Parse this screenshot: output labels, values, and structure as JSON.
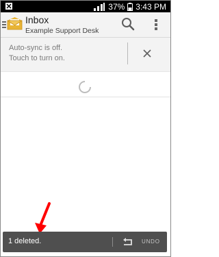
{
  "status": {
    "battery_percent": "37%",
    "time": "3:43 PM"
  },
  "header": {
    "title": "Inbox",
    "account": "Example Support Desk"
  },
  "banner": {
    "line1": "Auto-sync is off.",
    "line2": "Touch to turn on."
  },
  "toast": {
    "message": "1 deleted.",
    "action": "UNDO"
  },
  "icons": {
    "menu": "menu-icon",
    "app": "mail-envelope-icon",
    "search": "search-icon",
    "overflow": "more-vert-icon",
    "dismiss": "close-icon",
    "undo": "undo-icon",
    "loading": "spinner-icon"
  },
  "colors": {
    "status_bar": "#000000",
    "app_bar": "#f3f3f3",
    "toast": "#4f4f4f",
    "annotation_arrow": "#ff0000"
  }
}
